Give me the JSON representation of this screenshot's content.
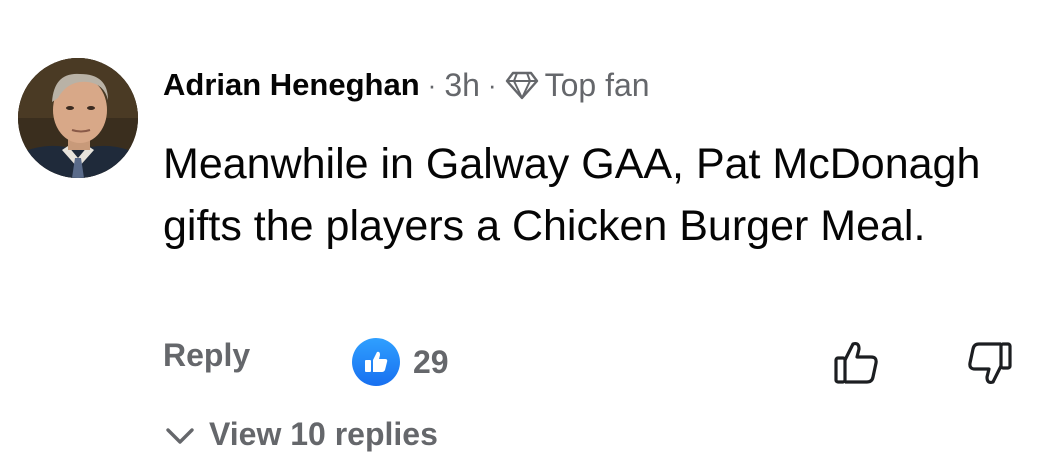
{
  "comment": {
    "author": "Adrian Heneghan",
    "separator": "·",
    "time": "3h",
    "badge_icon": "diamond-icon",
    "badge_label": "Top fan",
    "text": "Meanwhile in Galway GAA, Pat McDonagh gifts the players a Chicken Burger Meal.",
    "reply_label": "Reply",
    "reaction_icon": "thumbs-up-icon",
    "reaction_count": "29",
    "upvote_icon": "thumbs-up-outline-icon",
    "downvote_icon": "thumbs-down-outline-icon",
    "view_replies_label": "View 10 replies",
    "colors": {
      "text": "#050505",
      "muted": "#65676b",
      "like_blue": "#1877f2"
    }
  }
}
